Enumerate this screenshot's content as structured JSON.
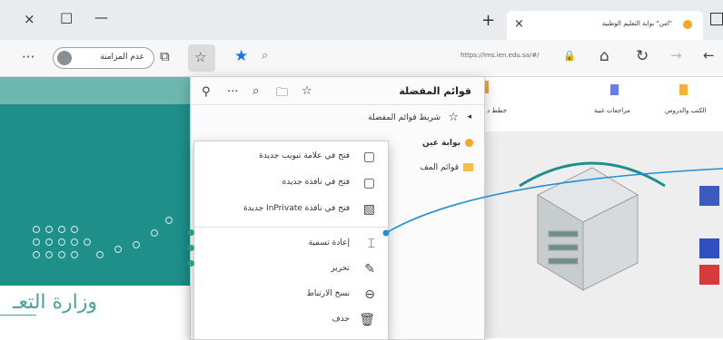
{
  "tab": {
    "title": "\"امن\" بوابة التعليم الوطنية",
    "close_glyph": "×"
  },
  "new_tab_glyph": "+",
  "window_controls": {
    "close": "×",
    "maximize": "□",
    "minimize": "—"
  },
  "address": {
    "url": "https://lms.ien.edu.sa/#/"
  },
  "profile": {
    "label": "عدم المزامنة"
  },
  "page_nav": {
    "items": [
      "الكتب والدروس",
      "مراجعات غنية",
      "خطط د"
    ]
  },
  "favorites": {
    "title": "قوائم المفضلة",
    "folder_bar": "شريط قوائم المفضلة",
    "items": [
      "بوابة عين",
      "قوائم المف"
    ]
  },
  "context_menu": {
    "items": [
      {
        "label": "فتح في علامة تبويب جديدة",
        "icon": "new-tab-icon",
        "glyph": "▢"
      },
      {
        "label": "فتح في نافذة جديدة",
        "icon": "new-window-icon",
        "glyph": "▢"
      },
      {
        "label": "فتح في نافذة InPrivate جديدة",
        "icon": "inprivate-window-icon",
        "glyph": "▧"
      },
      {
        "label": "إعادة تسمية",
        "icon": "rename-icon",
        "glyph": "⌶"
      },
      {
        "label": "تحرير",
        "icon": "edit-pencil-icon",
        "glyph": "✎"
      },
      {
        "label": "نسخ الارتباط",
        "icon": "copy-link-icon",
        "glyph": "⊖"
      },
      {
        "label": "حذف",
        "icon": "delete-trash-icon",
        "glyph": "🗑"
      }
    ]
  },
  "ministry": {
    "logo_text": "وزارة التعـ"
  },
  "colors": {
    "accent": "#1a73e8",
    "teal": "#1f8f8a",
    "callout": "#1e90d6",
    "dot": "#2f9e78"
  }
}
